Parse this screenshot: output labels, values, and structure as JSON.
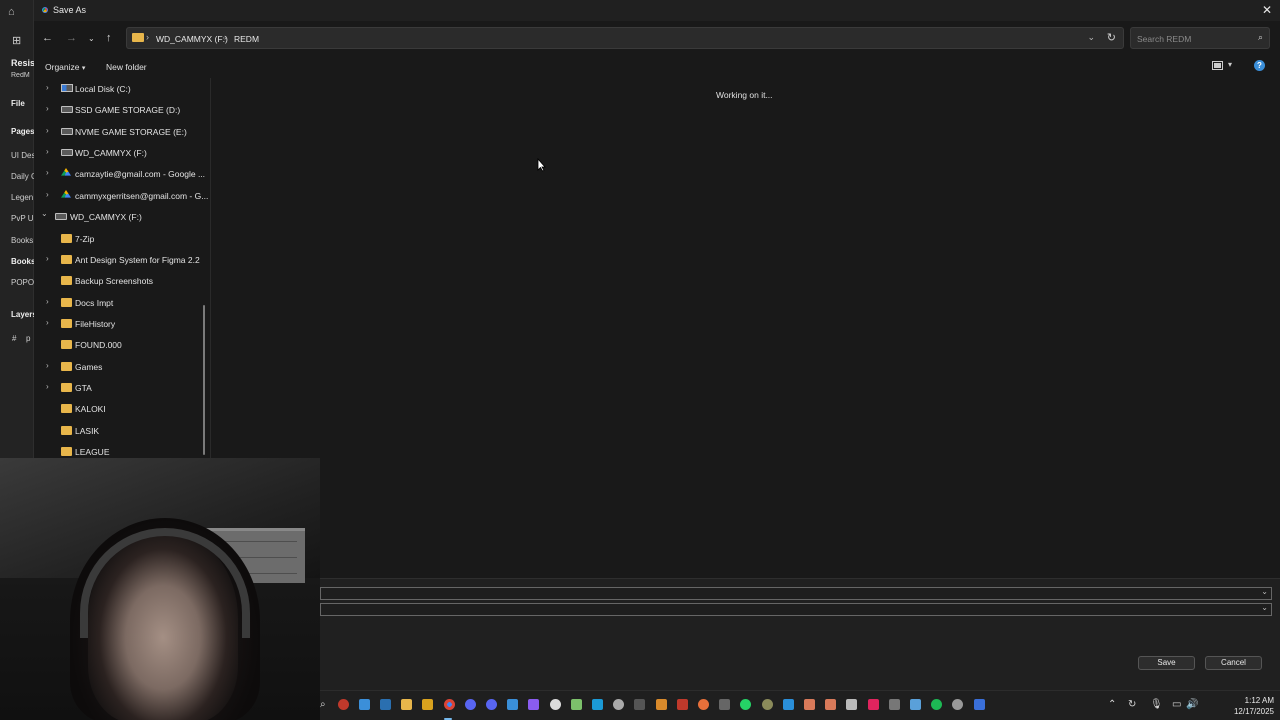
{
  "background_app": {
    "labels": [
      "Resis",
      "RedM",
      "File",
      "Pages",
      "UI Des",
      "Daily G",
      "Legen",
      "PvP UI",
      "Books",
      "Books",
      "POPOV",
      "Layers",
      "p"
    ]
  },
  "dialog": {
    "title": "Save As",
    "breadcrumb": [
      "WD_CAMMYX (F:)",
      "REDM"
    ],
    "search_placeholder": "Search REDM",
    "commands": {
      "organize": "Organize",
      "new_folder": "New folder"
    },
    "status_text": "Working on it...",
    "tree": [
      {
        "label": "Local Disk (C:)",
        "icon": "system-drive-icon",
        "expandable": true
      },
      {
        "label": "SSD GAME STORAGE (D:)",
        "icon": "drive-icon",
        "expandable": true
      },
      {
        "label": "NVME GAME STORAGE (E:)",
        "icon": "drive-icon",
        "expandable": true
      },
      {
        "label": "WD_CAMMYX (F:)",
        "icon": "drive-icon",
        "expandable": true
      },
      {
        "label": "camzaytie@gmail.com - Google ...",
        "icon": "google-drive-icon",
        "expandable": true
      },
      {
        "label": "cammyxgerritsen@gmail.com - G...",
        "icon": "google-drive-icon",
        "expandable": true
      },
      {
        "label": "WD_CAMMYX (F:)",
        "icon": "drive-icon",
        "expandable": true,
        "expanded": true
      },
      {
        "label": "7-Zip",
        "icon": "folder-icon",
        "expandable": false
      },
      {
        "label": "Ant Design System for Figma 2.2",
        "icon": "folder-icon",
        "expandable": true
      },
      {
        "label": "Backup Screenshots",
        "icon": "folder-icon",
        "expandable": false
      },
      {
        "label": "Docs Impt",
        "icon": "folder-icon",
        "expandable": true
      },
      {
        "label": "FileHistory",
        "icon": "folder-icon",
        "expandable": true
      },
      {
        "label": "FOUND.000",
        "icon": "folder-icon",
        "expandable": false
      },
      {
        "label": "Games",
        "icon": "folder-icon",
        "expandable": true
      },
      {
        "label": "GTA",
        "icon": "folder-icon",
        "expandable": true
      },
      {
        "label": "KALOKI",
        "icon": "folder-icon",
        "expandable": false
      },
      {
        "label": "LASIK",
        "icon": "folder-icon",
        "expandable": false
      },
      {
        "label": "LEAGUE",
        "icon": "folder-icon",
        "expandable": false
      }
    ],
    "buttons": {
      "save": "Save",
      "cancel": "Cancel"
    }
  },
  "taskbar": {
    "time": "1:12 AM",
    "date": "12/17/2025"
  }
}
